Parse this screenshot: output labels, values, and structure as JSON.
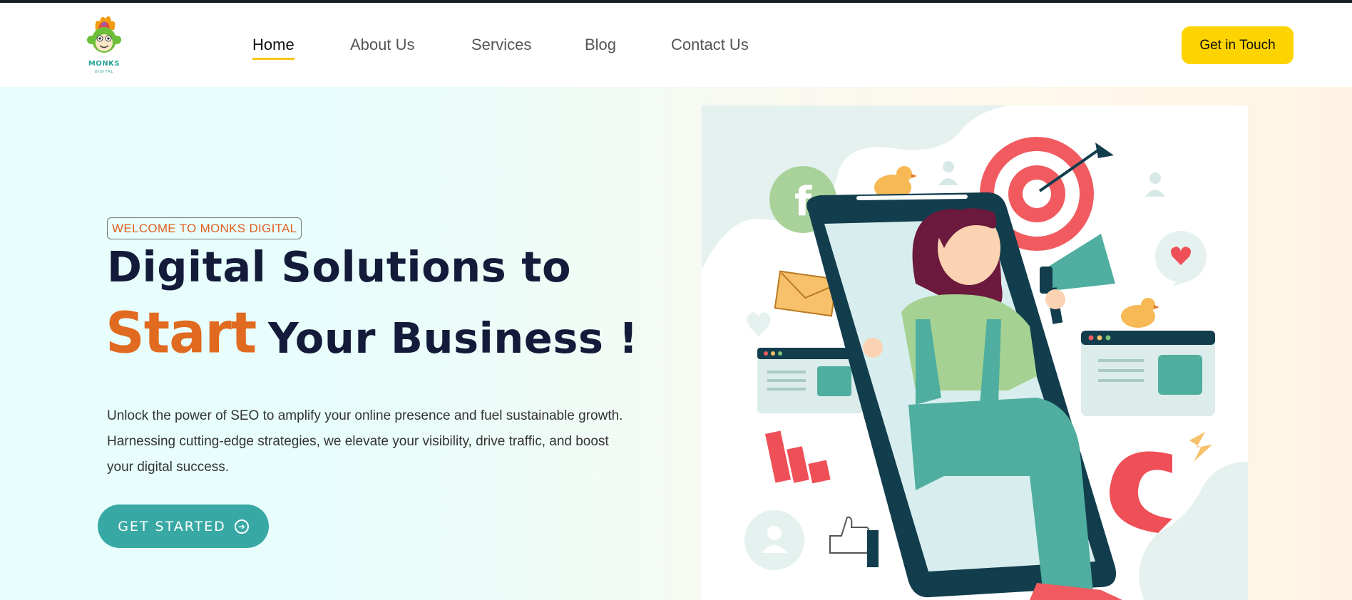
{
  "logo": {
    "text": "MONKS",
    "sub": "DIGITAL"
  },
  "nav": {
    "items": [
      {
        "label": "Home",
        "active": true
      },
      {
        "label": "About Us",
        "active": false
      },
      {
        "label": "Services",
        "active": false
      },
      {
        "label": "Blog",
        "active": false
      },
      {
        "label": "Contact Us",
        "active": false
      }
    ]
  },
  "header": {
    "cta_label": "Get in Touch"
  },
  "hero": {
    "badge": "WELCOME TO MONKS DIGITAL",
    "title_line1": "Digital Solutions to",
    "title_highlight": "Start",
    "title_line2": "Your Business !",
    "description": "Unlock the power of SEO to amplify your online presence and fuel sustainable growth. Harnessing cutting-edge strategies, we elevate your visibility, drive traffic, and boost your digital success.",
    "cta_label": "GET STARTED"
  },
  "illustration": {
    "facebook_letter": "f"
  },
  "colors": {
    "accent_yellow": "#fdd400",
    "accent_orange": "#e06a20",
    "teal": "#38a8a4",
    "navy": "#141b3a"
  },
  "icons": [
    "monkey-logo-icon",
    "arrow-circle-right-icon",
    "facebook-icon",
    "target-icon",
    "megaphone-icon",
    "envelope-icon",
    "heart-icon",
    "magnet-icon",
    "thumbs-up-icon",
    "bar-chart-icon",
    "user-icon",
    "bird-icon"
  ]
}
